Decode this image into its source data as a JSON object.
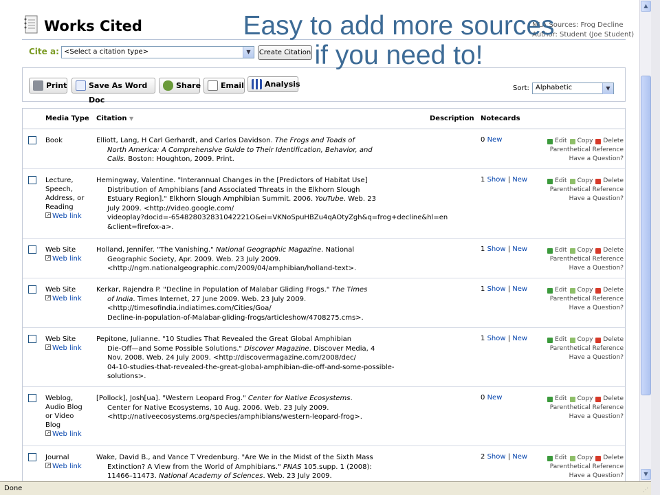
{
  "header": {
    "title": "Works Cited",
    "user_line1": "MLA Sources: Frog Decline",
    "user_line2": "Author: Student (Joe Student)",
    "cite_label": "Cite a:",
    "cite_select": "<Select a citation type>",
    "create_button": "Create Citation"
  },
  "overlay": {
    "line1": "Easy to add more sources",
    "line2": "if you need to!",
    "color": "#3d6b96"
  },
  "toolbar": {
    "print": "Print",
    "word": "Save As Word Doc",
    "share": "Share",
    "email": "Email",
    "analysis": "Analysis",
    "sort_label": "Sort:",
    "sort_value": "Alphabetic"
  },
  "table": {
    "headers": {
      "media": "Media Type",
      "citation": "Citation",
      "description": "Description",
      "notecards": "Notecards"
    },
    "actions": {
      "edit": "Edit",
      "copy": "Copy",
      "delete": "Delete",
      "parenthetical": "Parenthetical Reference",
      "question": "Have a Question?"
    },
    "weblink": "Web link",
    "rows": [
      {
        "media": [
          "Book"
        ],
        "weblink": false,
        "citation": [
          [
            {
              "t": "Elliott, Lang, H Carl Gerhardt, and Carlos Davidson. "
            },
            {
              "t": "The Frogs and Toads of",
              "i": true
            }
          ],
          [
            {
              "t": "North America: A Comprehensive Guide to Their Identification, Behavior, and",
              "i": true
            }
          ],
          [
            {
              "t": "Calls",
              "i": true
            },
            {
              "t": ". Boston: Houghton, 2009. Print."
            }
          ]
        ],
        "count": "0",
        "links": [
          "New"
        ]
      },
      {
        "media": [
          "Lecture,",
          "Speech,",
          "Address, or",
          "Reading"
        ],
        "weblink": true,
        "citation": [
          [
            {
              "t": "Hemingway, Valentine. \"Interannual Changes in the [Predictors of Habitat Use]"
            }
          ],
          [
            {
              "t": "Distribution of Amphibians [and Associated Threats in the Elkhorn Slough"
            }
          ],
          [
            {
              "t": "Estuary Region].\" Elkhorn Slough Amphibian Summit. 2006. "
            },
            {
              "t": "YouTube",
              "i": true
            },
            {
              "t": ". Web. 23"
            }
          ],
          [
            {
              "t": "July 2009. <http://video.google.com/"
            }
          ],
          [
            {
              "t": "videoplay?docid=-654828032831042221O&ei=VKNoSpuHBZu4qAOtyZgh&q=frog+decline&hl=en"
            }
          ],
          [
            {
              "t": "&client=firefox-a>."
            }
          ]
        ],
        "count": "1",
        "links": [
          "Show",
          "New"
        ]
      },
      {
        "media": [
          "Web Site"
        ],
        "weblink": true,
        "citation": [
          [
            {
              "t": "Holland, Jennifer. \"The Vanishing.\" "
            },
            {
              "t": "National Geographic Magazine",
              "i": true
            },
            {
              "t": ". National"
            }
          ],
          [
            {
              "t": "Geographic Society, Apr. 2009. Web. 23 July 2009."
            }
          ],
          [
            {
              "t": "<http://ngm.nationalgeographic.com/2009/04/amphibian/holland-text>."
            }
          ]
        ],
        "count": "1",
        "links": [
          "Show",
          "New"
        ]
      },
      {
        "media": [
          "Web Site"
        ],
        "weblink": true,
        "citation": [
          [
            {
              "t": "Kerkar, Rajendra P. \"Decline in Population of Malabar Gliding Frogs.\" "
            },
            {
              "t": "The Times",
              "i": true
            }
          ],
          [
            {
              "t": "of India",
              "i": true
            },
            {
              "t": ". Times Internet, 27 June 2009. Web. 23 July 2009."
            }
          ],
          [
            {
              "t": "<http://timesofindia.indiatimes.com/Cities/Goa/"
            }
          ],
          [
            {
              "t": "Decline-in-population-of-Malabar-gliding-frogs/articleshow/4708275.cms>."
            }
          ]
        ],
        "count": "1",
        "links": [
          "Show",
          "New"
        ]
      },
      {
        "media": [
          "Web Site"
        ],
        "weblink": true,
        "citation": [
          [
            {
              "t": "Pepitone, Julianne. \"10 Studies That Revealed the Great Global Amphibian"
            }
          ],
          [
            {
              "t": "Die-Off—and Some Possible Solutions.\" "
            },
            {
              "t": "Discover Magazine",
              "i": true
            },
            {
              "t": ". Discover Media, 4"
            }
          ],
          [
            {
              "t": "Nov. 2008. Web. 24 July 2009. <http://discovermagazine.com/2008/dec/"
            }
          ],
          [
            {
              "t": "04-10-studies-that-revealed-the-great-global-amphibian-die-off-and-some-possible-"
            }
          ],
          [
            {
              "t": "solutions>."
            }
          ]
        ],
        "count": "1",
        "links": [
          "Show",
          "New"
        ]
      },
      {
        "media": [
          "Weblog,",
          "Audio Blog",
          "or Video",
          "Blog"
        ],
        "weblink": true,
        "citation": [
          [
            {
              "t": "[Pollock], Josh[ua]. \"Western Leopard Frog.\" "
            },
            {
              "t": "Center for Native Ecosystems",
              "i": true
            },
            {
              "t": "."
            }
          ],
          [
            {
              "t": "Center for Native Ecosystems, 10 Aug. 2006. Web. 23 July 2009."
            }
          ],
          [
            {
              "t": "<http://nativeecosystems.org/species/amphibians/western-leopard-frog>."
            }
          ]
        ],
        "count": "0",
        "links": [
          "New"
        ]
      },
      {
        "media": [
          "Journal"
        ],
        "weblink": true,
        "citation": [
          [
            {
              "t": "Wake, David B., and Vance T Vredenburg. \"Are We in the Midst of the Sixth Mass"
            }
          ],
          [
            {
              "t": "Extinction? A View from the World of Amphibians.\" "
            },
            {
              "t": "PNAS",
              "i": true
            },
            {
              "t": " 105.supp. 1 (2008):"
            }
          ],
          [
            {
              "t": "11466–11473. "
            },
            {
              "t": "National Academy of Sciences",
              "i": true
            },
            {
              "t": ". Web. 23 July 2009."
            }
          ]
        ],
        "count": "2",
        "links": [
          "Show",
          "New"
        ]
      }
    ]
  },
  "status": "Done"
}
